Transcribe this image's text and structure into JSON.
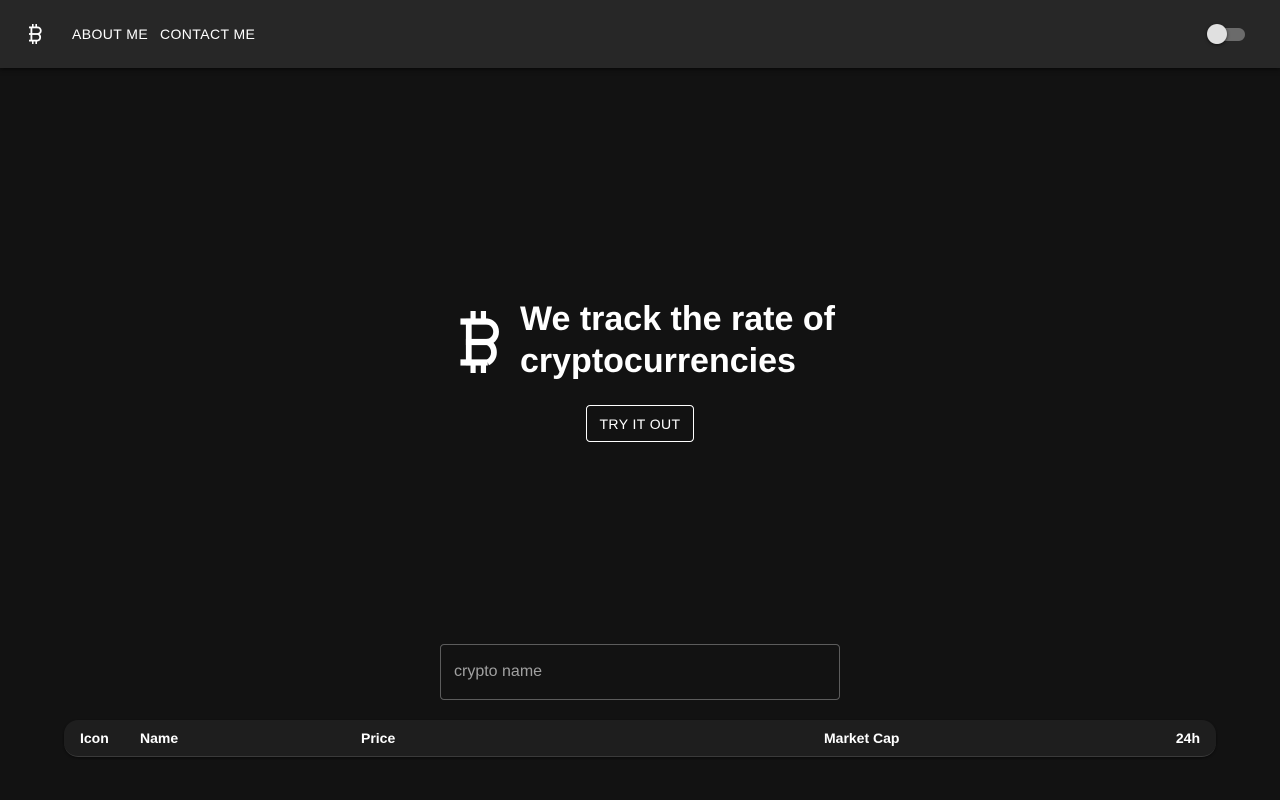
{
  "header": {
    "logo_icon": "bitcoin-icon",
    "nav": [
      {
        "label": "ABOUT ME"
      },
      {
        "label": "CONTACT ME"
      }
    ],
    "theme_toggle": {
      "checked": false
    }
  },
  "hero": {
    "icon": "bitcoin-icon",
    "title": "We track the rate of cryptocurrencies",
    "cta_label": "TRY IT OUT"
  },
  "search": {
    "placeholder": "crypto name",
    "value": ""
  },
  "table": {
    "columns": [
      "Icon",
      "Name",
      "Price",
      "Market Cap",
      "24h"
    ],
    "rows": []
  },
  "colors": {
    "background": "#121212",
    "appbar": "#272727",
    "text": "#ffffff"
  }
}
